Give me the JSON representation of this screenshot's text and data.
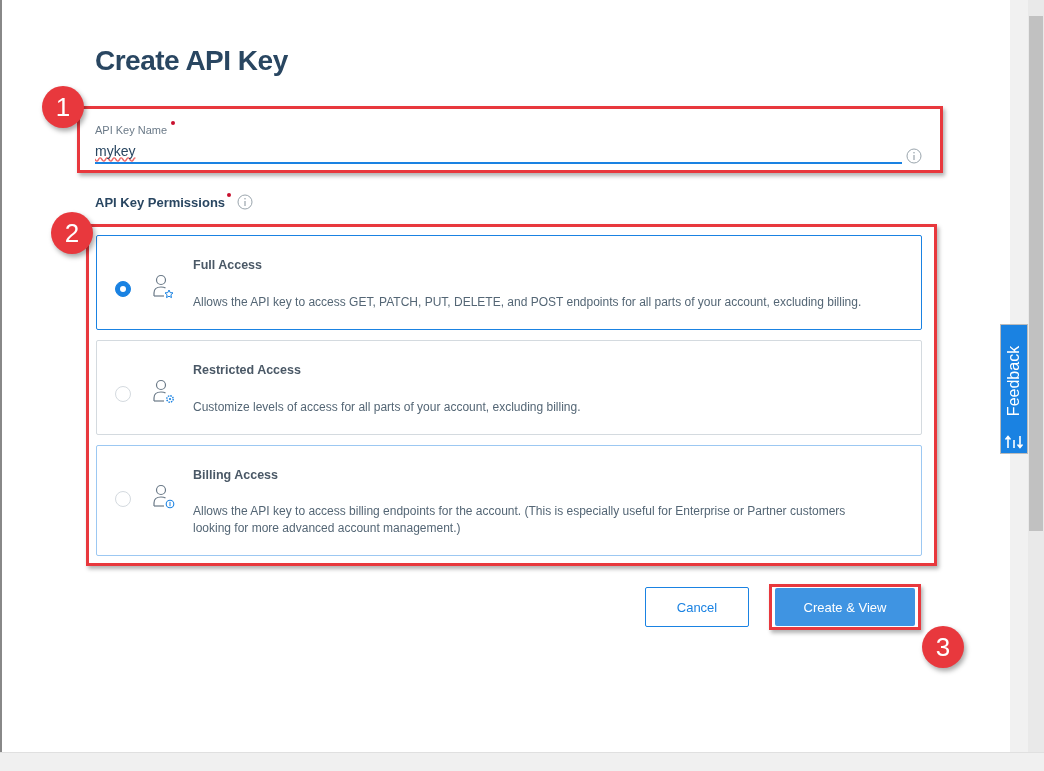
{
  "title": "Create API Key",
  "name_field": {
    "label": "API Key Name",
    "required": true,
    "value": "mykey",
    "callout": "1"
  },
  "permissions": {
    "label": "API Key Permissions",
    "required": true,
    "callout": "2",
    "options": [
      {
        "kind": "full",
        "title": "Full Access",
        "description": "Allows the API key to access GET, PATCH, PUT, DELETE, and POST endpoints for all parts of your account, excluding billing.",
        "selected": true
      },
      {
        "kind": "restricted",
        "title": "Restricted Access",
        "description": "Customize levels of access for all parts of your account, excluding billing.",
        "selected": false
      },
      {
        "kind": "billing",
        "title": "Billing Access",
        "description": "Allows the API key to access billing endpoints for the account. (This is especially useful for Enterprise or Partner customers looking for more advanced account management.)",
        "selected": false
      }
    ]
  },
  "buttons": [
    {
      "kind": "secondary",
      "label": "Cancel"
    },
    {
      "kind": "primary",
      "label": "Create & View",
      "callout": "3"
    }
  ],
  "feedback_tab": {
    "label": "Feedback"
  }
}
